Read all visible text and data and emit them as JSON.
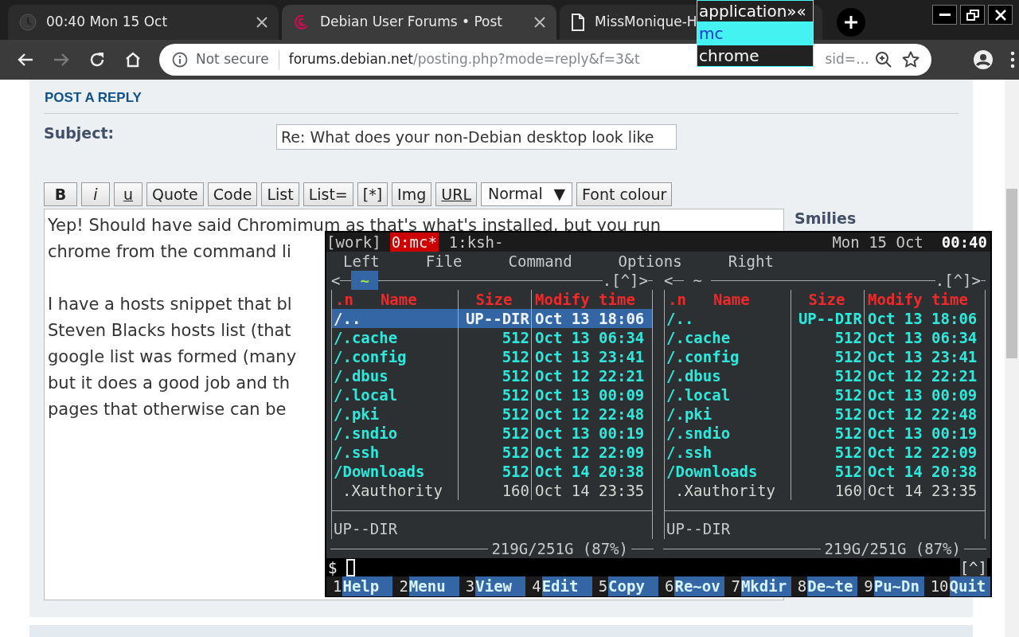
{
  "browser": {
    "tabs": [
      {
        "title": "00:40 Mon 15 Oct",
        "kind": "app",
        "selected": false
      },
      {
        "title": "Debian User Forums • Post",
        "kind": "site",
        "selected": true
      },
      {
        "title": "MissMonique-H",
        "kind": "document",
        "selected": false
      }
    ],
    "nav_buttons": [
      {
        "kind": "back",
        "disabled": false
      },
      {
        "kind": "forward",
        "disabled": true
      },
      {
        "kind": "reload",
        "disabled": false
      },
      {
        "kind": "home",
        "disabled": false
      }
    ],
    "address_bar": {
      "security": "Not secure",
      "host": "forums.debian.net",
      "path": "/posting.php?mode=reply&f=3&t",
      "path_tail": "sid=…"
    }
  },
  "launcher": {
    "prompt": "application»«",
    "items": [
      {
        "label": "mc",
        "selected": true
      },
      {
        "label": "chrome",
        "selected": false
      }
    ]
  },
  "form": {
    "heading": "POST A REPLY",
    "subject_label": "Subject:",
    "subject_value": "Re: What does your non-Debian desktop look like",
    "toolbar": [
      {
        "label": "B",
        "kind": "bold"
      },
      {
        "label": "i",
        "kind": "italic"
      },
      {
        "label": "u",
        "kind": "underline"
      },
      {
        "label": "Quote",
        "kind": "plain"
      },
      {
        "label": "Code",
        "kind": "plain"
      },
      {
        "label": "List",
        "kind": "plain"
      },
      {
        "label": "List=",
        "kind": "plain"
      },
      {
        "label": "[*]",
        "kind": "plain"
      },
      {
        "label": "Img",
        "kind": "plain"
      },
      {
        "label": "URL",
        "kind": "link"
      },
      {
        "label": "Normal",
        "kind": "select",
        "arrow": "▼"
      },
      {
        "label": "Font colour",
        "kind": "plain"
      }
    ],
    "message": [
      [
        "Yep! Should have said Chromimum as that's what's installed, but you run",
        "chrome from the command li"
      ],
      [
        "I have a hosts snippet that bl",
        "Steven Blacks hosts list (that",
        "google list was formed (many",
        "but it does a good job and th",
        "pages that otherwise can be"
      ]
    ],
    "smilies_label": "Smilies"
  },
  "terminal": {
    "session": "[work]",
    "windows": [
      {
        "label": "0:mc*",
        "selected": true
      },
      {
        "label": "1:ksh-",
        "selected": false
      }
    ],
    "date": "Mon 15 Oct",
    "time": "00:40",
    "menu": [
      "Left",
      "File",
      "Command",
      "Options",
      "Right"
    ],
    "panels": [
      {
        "left_mark": "<",
        "path": "~",
        "right_mark": ".[^]>",
        "active": true,
        "columns": {
          "mark": ".n",
          "name": "Name",
          "size": "Size",
          "time": "Modify time"
        },
        "rows": [
          {
            "name": "/..",
            "size": "UP--DIR",
            "time": "Oct 13 18:06",
            "kind": "directory",
            "selected": true
          },
          {
            "name": "/.cache",
            "size": "512",
            "time": "Oct 13 06:34",
            "kind": "directory",
            "selected": false
          },
          {
            "name": "/.config",
            "size": "512",
            "time": "Oct 13 23:41",
            "kind": "directory",
            "selected": false
          },
          {
            "name": "/.dbus",
            "size": "512",
            "time": "Oct 12 22:21",
            "kind": "directory",
            "selected": false
          },
          {
            "name": "/.local",
            "size": "512",
            "time": "Oct 13 00:09",
            "kind": "directory",
            "selected": false
          },
          {
            "name": "/.pki",
            "size": "512",
            "time": "Oct 12 22:48",
            "kind": "directory",
            "selected": false
          },
          {
            "name": "/.sndio",
            "size": "512",
            "time": "Oct 13 00:19",
            "kind": "directory",
            "selected": false
          },
          {
            "name": "/.ssh",
            "size": "512",
            "time": "Oct 12 22:09",
            "kind": "directory",
            "selected": false
          },
          {
            "name": "/Downloads",
            "size": "512",
            "time": "Oct 14 20:38",
            "kind": "directory",
            "selected": false
          },
          {
            "name": ".Xauthority",
            "size": "160",
            "time": "Oct 14 23:35",
            "kind": "file",
            "selected": false
          }
        ],
        "info": "UP--DIR",
        "usage": "219G/251G (87%)"
      },
      {
        "left_mark": "<",
        "path": "~",
        "right_mark": ".[^]>",
        "active": false,
        "columns": {
          "mark": ".n",
          "name": "Name",
          "size": "Size",
          "time": "Modify time"
        },
        "rows": [
          {
            "name": "/..",
            "size": "UP--DIR",
            "time": "Oct 13 18:06",
            "kind": "directory",
            "selected": false
          },
          {
            "name": "/.cache",
            "size": "512",
            "time": "Oct 13 06:34",
            "kind": "directory",
            "selected": false
          },
          {
            "name": "/.config",
            "size": "512",
            "time": "Oct 13 23:41",
            "kind": "directory",
            "selected": false
          },
          {
            "name": "/.dbus",
            "size": "512",
            "time": "Oct 12 22:21",
            "kind": "directory",
            "selected": false
          },
          {
            "name": "/.local",
            "size": "512",
            "time": "Oct 13 00:09",
            "kind": "directory",
            "selected": false
          },
          {
            "name": "/.pki",
            "size": "512",
            "time": "Oct 12 22:48",
            "kind": "directory",
            "selected": false
          },
          {
            "name": "/.sndio",
            "size": "512",
            "time": "Oct 13 00:19",
            "kind": "directory",
            "selected": false
          },
          {
            "name": "/.ssh",
            "size": "512",
            "time": "Oct 12 22:09",
            "kind": "directory",
            "selected": false
          },
          {
            "name": "/Downloads",
            "size": "512",
            "time": "Oct 14 20:38",
            "kind": "directory",
            "selected": false
          },
          {
            "name": ".Xauthority",
            "size": "160",
            "time": "Oct 14 23:35",
            "kind": "file",
            "selected": false
          }
        ],
        "info": "UP--DIR",
        "usage": "219G/251G (87%)"
      }
    ],
    "prompt": "$",
    "scroll_mark": "[^]",
    "keys": [
      {
        "number": "1",
        "label": "Help"
      },
      {
        "number": "2",
        "label": "Menu"
      },
      {
        "number": "3",
        "label": "View"
      },
      {
        "number": "4",
        "label": "Edit"
      },
      {
        "number": "5",
        "label": "Copy"
      },
      {
        "number": "6",
        "label": "Re~ov"
      },
      {
        "number": "7",
        "label": "Mkdir"
      },
      {
        "number": "8",
        "label": "De~te"
      },
      {
        "number": "9",
        "label": "Pu~Dn"
      },
      {
        "number": "10",
        "label": "Quit"
      }
    ]
  }
}
